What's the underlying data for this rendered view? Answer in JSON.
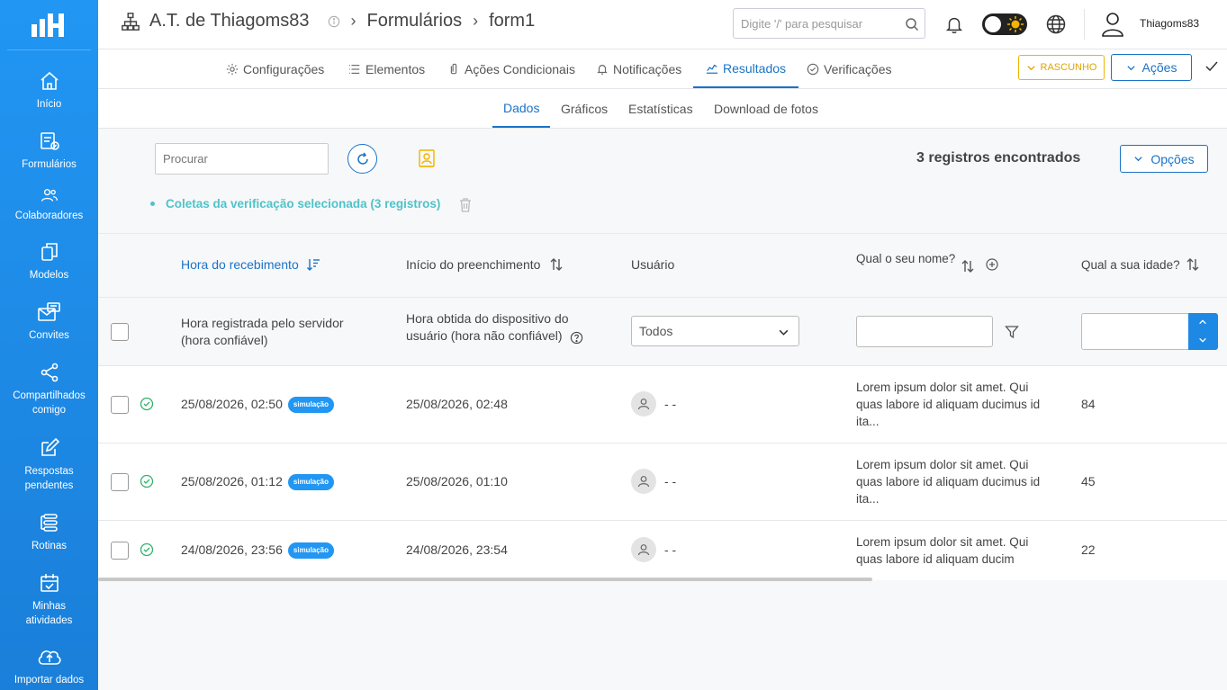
{
  "sidebar": {
    "items": [
      {
        "label": "Início",
        "icon": "home-icon"
      },
      {
        "label": "Formulários",
        "icon": "forms-icon"
      },
      {
        "label": "Colaboradores",
        "icon": "users-icon"
      },
      {
        "label": "Modelos",
        "icon": "copy-icon"
      },
      {
        "label": "Convites",
        "icon": "mail-icon"
      },
      {
        "label": "Compartilhados comigo",
        "icon": "share-icon"
      },
      {
        "label": "Respostas pendentes",
        "icon": "edit-icon"
      },
      {
        "label": "Rotinas",
        "icon": "routine-icon"
      },
      {
        "label": "Minhas atividades",
        "icon": "calendar-check-icon"
      },
      {
        "label": "Importar dados",
        "icon": "cloud-upload-icon"
      }
    ]
  },
  "header": {
    "org": "A.T. de Thiagoms83",
    "section": "Formulários",
    "form": "form1",
    "search_placeholder": "Digite '/' para pesquisar",
    "username": "Thiagoms83"
  },
  "tabs": [
    {
      "label": "Configurações",
      "icon": "gear-icon"
    },
    {
      "label": "Elementos",
      "icon": "list-icon"
    },
    {
      "label": "Ações Condicionais",
      "icon": "clip-icon"
    },
    {
      "label": "Notificações",
      "icon": "bell-icon"
    },
    {
      "label": "Resultados",
      "icon": "chart-icon",
      "active": true
    },
    {
      "label": "Verificações",
      "icon": "check-circle-icon"
    }
  ],
  "status_badge": "RASCUNHO",
  "actions_label": "Ações",
  "subtabs": [
    "Dados",
    "Gráficos",
    "Estatísticas",
    "Download de fotos"
  ],
  "toolbar": {
    "search_placeholder": "Procurar",
    "records_found": "3 registros encontrados",
    "options_label": "Opções",
    "filter_chip": "Coletas da verificação selecionada (3 registros)"
  },
  "columns": {
    "received": "Hora do recebimento",
    "started": "Início do preenchimento",
    "user": "Usuário",
    "name_q": "Qual o seu nome?",
    "age_q": "Qual a sua idade?"
  },
  "filters": {
    "received_desc_1": "Hora registrada pelo servidor",
    "received_desc_2": "(hora confiável)",
    "started_desc_1": "Hora obtida do dispositivo do",
    "started_desc_2": "usuário (hora não confiável)",
    "user_select": "Todos"
  },
  "rows": [
    {
      "received": "25/08/2026, 02:50",
      "badge": "simulação",
      "started": "25/08/2026, 02:48",
      "user": "- -",
      "name_1": "Lorem ipsum dolor sit amet. Qui",
      "name_2": "quas labore id aliquam ducimus id",
      "name_3": "ita...",
      "age": "84"
    },
    {
      "received": "25/08/2026, 01:12",
      "badge": "simulação",
      "started": "25/08/2026, 01:10",
      "user": "- -",
      "name_1": "Lorem ipsum dolor sit amet. Qui",
      "name_2": "quas labore id aliquam ducimus id",
      "name_3": "ita...",
      "age": "45"
    },
    {
      "received": "24/08/2026, 23:56",
      "badge": "simulação",
      "started": "24/08/2026, 23:54",
      "user": "- -",
      "name_1": "Lorem ipsum dolor sit amet. Qui",
      "name_2": "quas labore id aliquam ducim",
      "name_3": "",
      "age": "22"
    }
  ],
  "colors": {
    "primary": "#1a73c7",
    "sidebar": "#2196f3",
    "success": "#2fb36b",
    "draft": "#f0b400",
    "chip": "#4fc3c9"
  }
}
